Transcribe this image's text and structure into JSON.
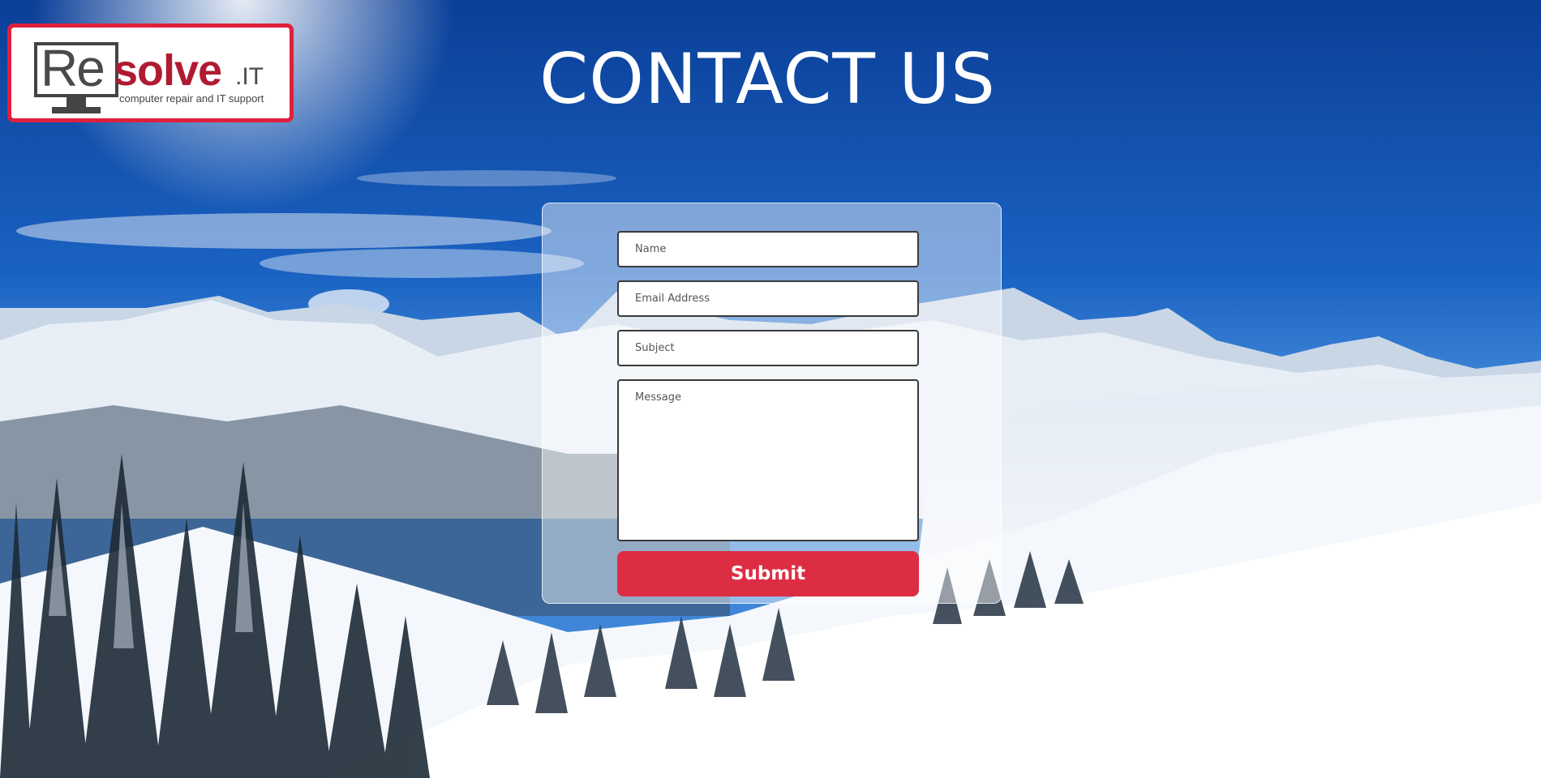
{
  "logo": {
    "re": "Re",
    "solve": "solve",
    "it": ".IT",
    "tagline": "computer repair and IT support",
    "border_color": "#e0203a",
    "accent_color": "#b01b32"
  },
  "header": {
    "title": "CONTACT US"
  },
  "form": {
    "name_placeholder": "Name",
    "email_placeholder": "Email Address",
    "subject_placeholder": "Subject",
    "message_placeholder": "Message",
    "name_value": "",
    "email_value": "",
    "subject_value": "",
    "message_value": "",
    "submit_label": "Submit",
    "submit_color": "#dd2d43"
  },
  "background": {
    "sky_color": "#0d47a8",
    "snow_color": "#f2f6fb"
  }
}
